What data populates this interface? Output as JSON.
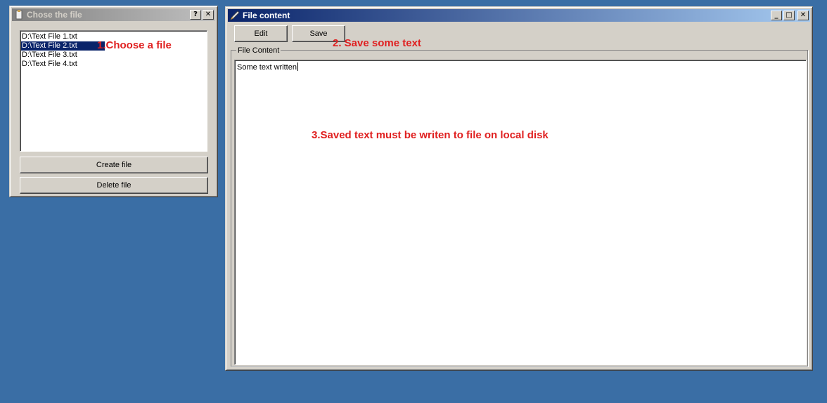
{
  "choose_window": {
    "title": "Chose the file",
    "help_button": "?",
    "close_button": "✕",
    "files": [
      "D:\\Text File 1.txt",
      "D:\\Text File 2.txt",
      "D:\\Text File 3.txt",
      "D:\\Text File 4.txt"
    ],
    "selected_index": 1,
    "create_label": "Create file",
    "delete_label": "Delete file"
  },
  "content_window": {
    "title": "File content",
    "minimize_button": "_",
    "maximize_button": "□",
    "close_button": "✕",
    "edit_label": "Edit",
    "save_label": "Save",
    "group_label": "File Content",
    "text_value": "Some text written"
  },
  "annotations": {
    "step1": "1.Choose a file",
    "step2": "2. Save some text",
    "step3": "3.Saved text must be writen to file on local disk",
    "color": "#e02020"
  },
  "colors": {
    "desktop": "#3a6ea5",
    "window_face": "#d4d0c8",
    "selection": "#0a246a"
  }
}
